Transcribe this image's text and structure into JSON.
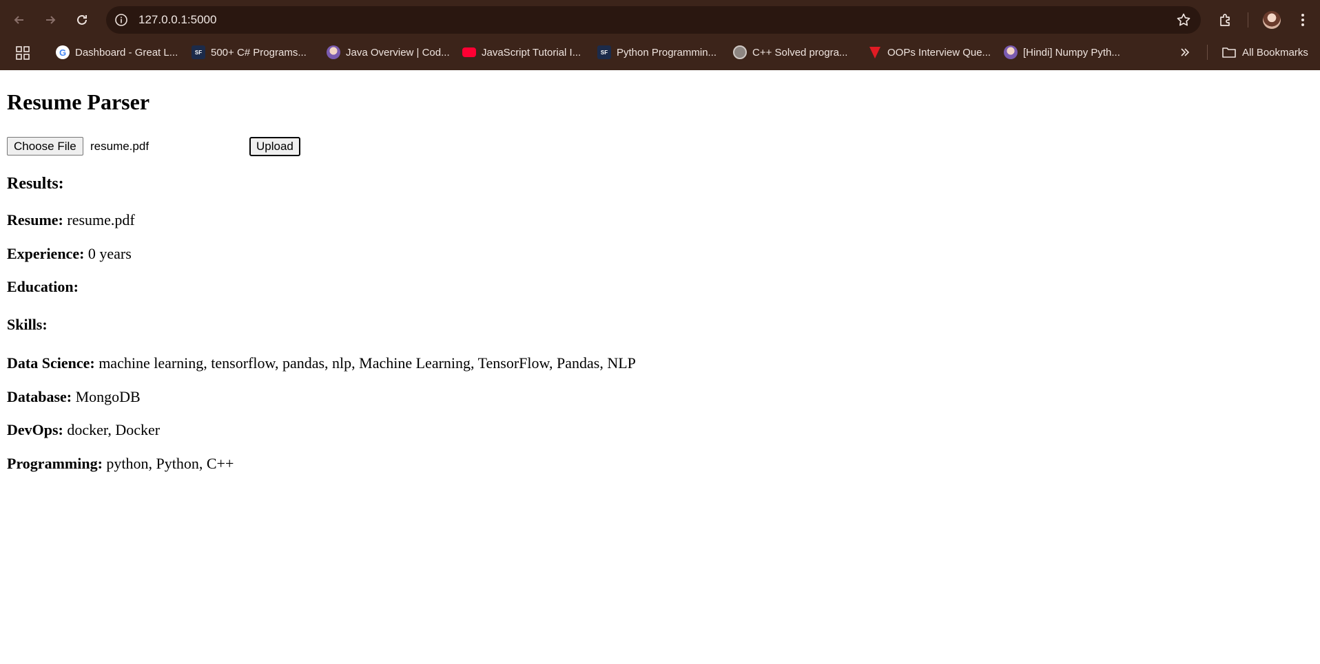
{
  "browser": {
    "url": "127.0.0.1:5000",
    "bookmarks": [
      {
        "label": "Dashboard - Great L...",
        "icon": "google-icon"
      },
      {
        "label": "500+ C# Programs...",
        "icon": "sf-icon"
      },
      {
        "label": "Java Overview | Cod...",
        "icon": "avatar-icon"
      },
      {
        "label": "JavaScript Tutorial I...",
        "icon": "youtube-icon"
      },
      {
        "label": "Python Programmin...",
        "icon": "sf-icon"
      },
      {
        "label": "C++ Solved progra...",
        "icon": "globe-icon"
      },
      {
        "label": "OOPs Interview Que...",
        "icon": "v-icon"
      },
      {
        "label": "[Hindi] Numpy Pyth...",
        "icon": "avatar-icon"
      }
    ],
    "all_bookmarks_label": "All Bookmarks"
  },
  "page": {
    "title": "Resume Parser",
    "choose_file_label": "Choose File",
    "selected_file": "resume.pdf",
    "upload_label": "Upload",
    "results_heading": "Results:",
    "resume_label": "Resume:",
    "resume_value": "resume.pdf",
    "experience_label": "Experience:",
    "experience_value": "0 years",
    "education_label": "Education:",
    "skills_heading": "Skills:",
    "skills": [
      {
        "label": "Data Science:",
        "value": "machine learning, tensorflow, pandas, nlp, Machine Learning, TensorFlow, Pandas, NLP"
      },
      {
        "label": "Database:",
        "value": "MongoDB"
      },
      {
        "label": "DevOps:",
        "value": "docker, Docker"
      },
      {
        "label": "Programming:",
        "value": "python, Python, C++"
      }
    ]
  },
  "colors": {
    "chrome_bg": "#3c241a",
    "omnibox_bg": "#2a1710"
  }
}
